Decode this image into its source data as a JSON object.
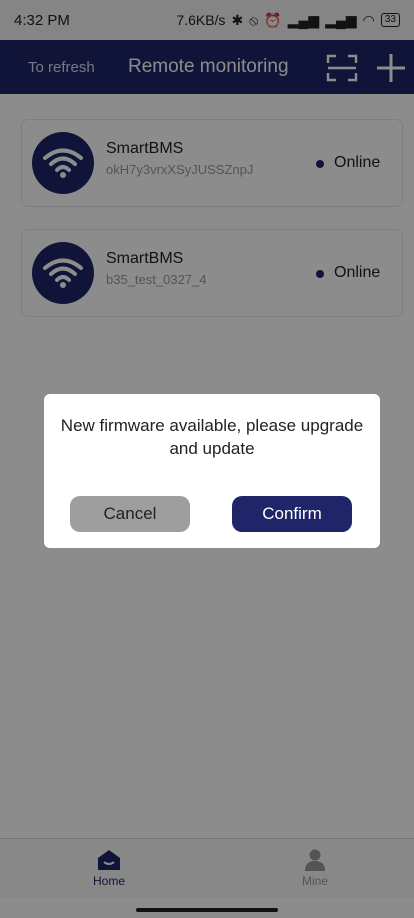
{
  "status_bar": {
    "time": "4:32 PM",
    "speed": "7.6KB/s",
    "icons": [
      "bluetooth-icon",
      "alarm-off-icon",
      "alarm-icon",
      "signal-icon",
      "signal-icon",
      "wifi-icon"
    ],
    "battery": "33"
  },
  "header": {
    "refresh_label": "To refresh",
    "title": "Remote monitoring",
    "scan_icon": "scan-icon",
    "add_icon": "plus-icon"
  },
  "devices": [
    {
      "name": "SmartBMS",
      "id": "okH7y3vrxXSyJUSSZnpJ",
      "status": "Online",
      "icon": "wifi-icon"
    },
    {
      "name": "SmartBMS",
      "id": "b35_test_0327_4",
      "status": "Online",
      "icon": "wifi-icon"
    }
  ],
  "dialog": {
    "message": "New firmware available, please upgrade and update",
    "cancel_label": "Cancel",
    "confirm_label": "Confirm"
  },
  "bottom_nav": {
    "items": [
      {
        "label": "Home",
        "icon": "home-icon",
        "active": true
      },
      {
        "label": "Mine",
        "icon": "user-icon",
        "active": false
      }
    ]
  },
  "colors": {
    "primary": "#1f2568",
    "overlay": "rgba(0,0,0,0.45)",
    "cancel": "#9e9e9e"
  }
}
